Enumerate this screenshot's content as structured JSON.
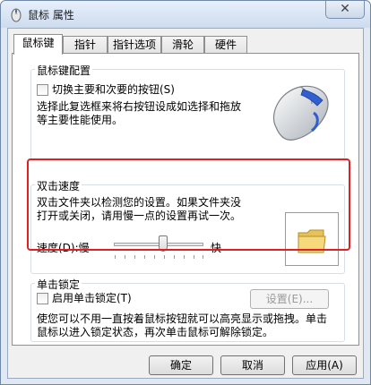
{
  "window": {
    "title": "鼠标 属性"
  },
  "tabs": [
    {
      "label": "鼠标键"
    },
    {
      "label": "指针"
    },
    {
      "label": "指针选项"
    },
    {
      "label": "滑轮"
    },
    {
      "label": "硬件"
    }
  ],
  "buttons_config": {
    "group_label": "鼠标键配置",
    "switch_label": "切换主要和次要的按钮(S)",
    "description": [
      "选择此复选框来将右按钮设成如选择和拖放",
      "等主要性能使用。"
    ]
  },
  "double_click": {
    "group_label": "双击速度",
    "description": [
      "双击文件夹以检测您的设置。如果文件夹没",
      "打开或关闭，请用慢一点的设置再试一次。"
    ],
    "speed_label": "速度(D):慢",
    "fast_label": "快",
    "speed_fraction": 0.55
  },
  "click_lock": {
    "group_label": "单击锁定",
    "enable_label": "启用单击锁定(T)",
    "settings_label": "设置(E)...",
    "description": [
      "使您可以不用一直按着鼠标按钮就可以高亮显示或拖拽。单击",
      "鼠标以进入锁定状态，再次单击鼠标可解除锁定。"
    ]
  },
  "footer": {
    "ok_label": "确定",
    "cancel_label": "取消",
    "apply_label": "应用(A)"
  }
}
